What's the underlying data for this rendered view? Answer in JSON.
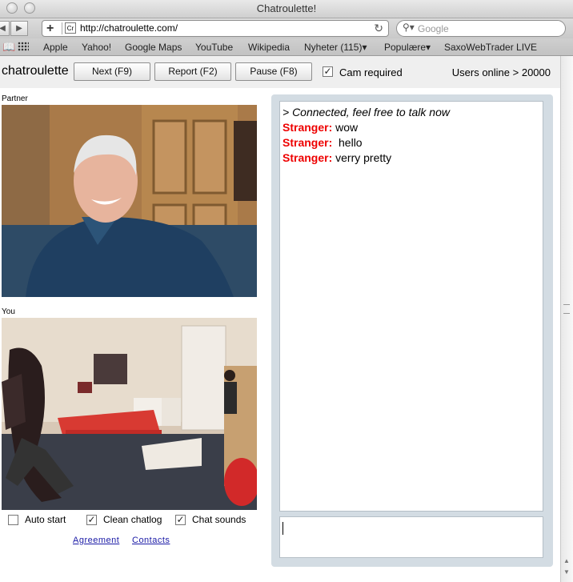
{
  "window": {
    "title": "Chatroulette!"
  },
  "browser": {
    "url": "http://chatroulette.com/",
    "favicon_label": "Cr",
    "search_placeholder": "Google",
    "bookmarks": [
      "Apple",
      "Yahoo!",
      "Google Maps",
      "YouTube",
      "Wikipedia",
      "Nyheter (115)▾",
      "Populære▾",
      "SaxoWebTrader LIVE"
    ]
  },
  "app": {
    "logo": "chatroulette",
    "buttons": {
      "next": "Next (F9)",
      "report": "Report (F2)",
      "pause": "Pause (F8)"
    },
    "cam_required": {
      "label": "Cam required",
      "checked": true
    },
    "users_online": "Users online > 20000",
    "partner_label": "Partner",
    "you_label": "You",
    "options": [
      {
        "label": "Auto start",
        "checked": false
      },
      {
        "label": "Clean chatlog",
        "checked": true
      },
      {
        "label": "Chat sounds",
        "checked": true
      }
    ],
    "links": {
      "agreement": "Agreement",
      "contacts": "Contacts"
    }
  },
  "chat": {
    "system_message": "> Connected, feel free to talk now",
    "messages": [
      {
        "sender": "Stranger:",
        "text": "wow"
      },
      {
        "sender": "Stranger:",
        "text": " hello"
      },
      {
        "sender": "Stranger:",
        "text": "verry pretty"
      }
    ],
    "input_value": ""
  },
  "colors": {
    "stranger": "#ee0000",
    "chat_panel": "#d3dce3",
    "link": "#1a1aa6"
  },
  "icons": [
    "back-icon",
    "forward-icon",
    "add-bookmark-icon",
    "reload-icon",
    "search-icon",
    "bookmarks-book-icon",
    "top-sites-grid-icon",
    "check-icon"
  ]
}
